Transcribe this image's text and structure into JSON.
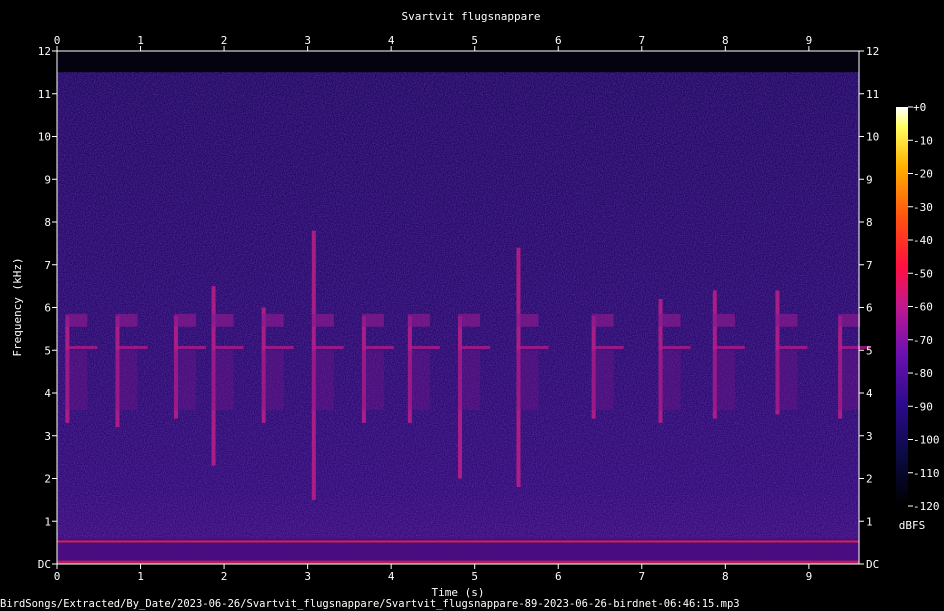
{
  "chart_data": {
    "type": "heatmap",
    "title": "Svartvit flugsnappare",
    "xlabel": "Time (s)",
    "ylabel": "Frequency (kHz)",
    "xlim": [
      0,
      9.6
    ],
    "ylim": [
      0,
      12
    ],
    "x_ticks": [
      "0",
      "1",
      "2",
      "3",
      "4",
      "5",
      "6",
      "7",
      "8",
      "9"
    ],
    "y_ticks": [
      "DC",
      "1",
      "2",
      "3",
      "4",
      "5",
      "6",
      "7",
      "8",
      "9",
      "10",
      "11",
      "12"
    ],
    "colorbar": {
      "label": "dBFS",
      "range": [
        -120,
        0
      ],
      "ticks": [
        "+0",
        "-10",
        "-20",
        "-30",
        "-40",
        "-50",
        "-60",
        "-70",
        "-80",
        "-90",
        "-100",
        "-110",
        "-120"
      ]
    },
    "calls": [
      {
        "t": 0.1,
        "f_low": 3.3,
        "f_high": 5.8
      },
      {
        "t": 0.7,
        "f_low": 3.2,
        "f_high": 5.8
      },
      {
        "t": 1.4,
        "f_low": 3.4,
        "f_high": 5.8
      },
      {
        "t": 1.85,
        "f_low": 2.3,
        "f_high": 6.5
      },
      {
        "t": 2.45,
        "f_low": 3.3,
        "f_high": 6.0
      },
      {
        "t": 3.05,
        "f_low": 1.5,
        "f_high": 7.8
      },
      {
        "t": 3.65,
        "f_low": 3.3,
        "f_high": 5.8
      },
      {
        "t": 4.2,
        "f_low": 3.3,
        "f_high": 5.8
      },
      {
        "t": 4.8,
        "f_low": 2.0,
        "f_high": 5.8
      },
      {
        "t": 5.5,
        "f_low": 1.8,
        "f_high": 7.4
      },
      {
        "t": 6.4,
        "f_low": 3.4,
        "f_high": 5.8
      },
      {
        "t": 7.2,
        "f_low": 3.3,
        "f_high": 6.2
      },
      {
        "t": 7.85,
        "f_low": 3.4,
        "f_high": 6.4
      },
      {
        "t": 8.6,
        "f_low": 3.5,
        "f_high": 6.4
      },
      {
        "t": 9.35,
        "f_low": 3.4,
        "f_high": 5.8
      }
    ]
  },
  "footer": {
    "path": "BirdSongs/Extracted/By_Date/2023-06-26/Svartvit_flugsnappare/Svartvit_flugsnappare-89-2023-06-26-birdnet-06:46:15.mp3"
  },
  "colors": {
    "background": "#000000",
    "spectrogram_base": "#2a0a6b",
    "call_color": "#d0208a",
    "low_band": "#ff2a40"
  }
}
